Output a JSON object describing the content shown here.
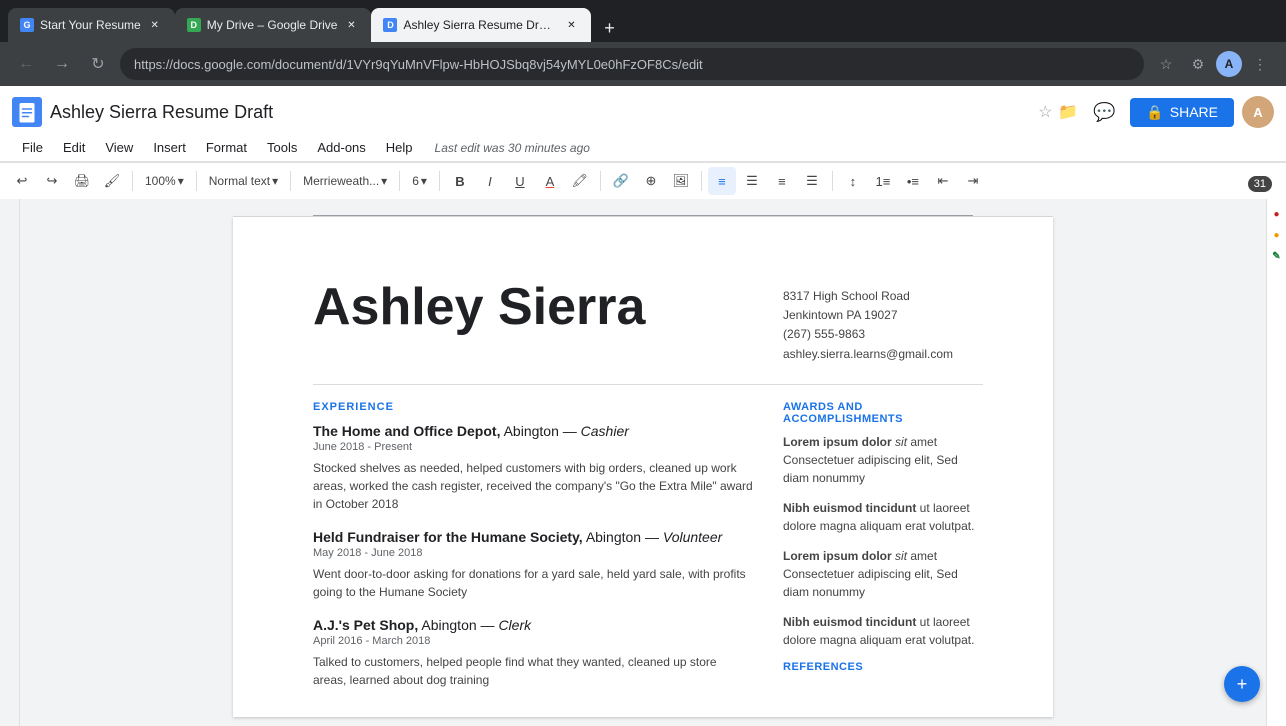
{
  "browser": {
    "tabs": [
      {
        "id": "tab1",
        "favicon_color": "#4285f4",
        "favicon_letter": "G",
        "title": "Start Your Resume",
        "active": false
      },
      {
        "id": "tab2",
        "favicon_color": "#34a853",
        "favicon_letter": "D",
        "title": "My Drive – Google Drive",
        "active": false
      },
      {
        "id": "tab3",
        "favicon_color": "#4285f4",
        "favicon_letter": "D",
        "title": "Ashley Sierra Resume Draft –",
        "active": true
      }
    ],
    "url": "https://docs.google.com/document/d/1VYr9qYuMnVFlpw-HbHOJSbq8vj54yMYL0e0hFzOF8Cs/edit"
  },
  "docs": {
    "title": "Ashley Sierra Resume Draft",
    "last_edit": "Last edit was 30 minutes ago",
    "menu": [
      "File",
      "Edit",
      "View",
      "Insert",
      "Format",
      "Tools",
      "Add-ons",
      "Help"
    ],
    "toolbar": {
      "zoom": "100%",
      "style": "Normal text",
      "font": "Merrieweath...",
      "font_size": "6"
    },
    "share_label": "SHARE"
  },
  "resume": {
    "name": "Ashley Sierra",
    "contact": {
      "address": "8317 High School Road",
      "city_state_zip": "Jenkintown PA 19027",
      "phone": "(267) 555-9863",
      "email": "ashley.sierra.learns@gmail.com"
    },
    "sections": {
      "experience": {
        "heading": "EXPERIENCE",
        "jobs": [
          {
            "title_bold": "The Home and Office Depot,",
            "title_regular": " Abington — ",
            "title_italic": "Cashier",
            "date": "June 2018 - Present",
            "description": "Stocked shelves as needed, helped customers with big orders, cleaned up work areas, worked the cash register, received the company's \"Go the Extra Mile\" award in October 2018"
          },
          {
            "title_bold": "Held Fundraiser for the Humane Society,",
            "title_regular": " Abington — ",
            "title_italic": "Volunteer",
            "date": "May 2018 - June 2018",
            "description": "Went door-to-door asking for donations for a yard sale, held yard sale, with profits going to the Humane Society"
          },
          {
            "title_bold": "A.J.'s Pet Shop,",
            "title_regular": " Abington — ",
            "title_italic": "Clerk",
            "date": "April 2016 - March 2018",
            "description": "Talked to customers, helped people find what they wanted, cleaned up store areas, learned about dog training"
          }
        ]
      },
      "awards": {
        "heading": "AWARDS AND ACCOMPLISHMENTS",
        "entries": [
          {
            "text_bold": "Lorem ipsum dolor",
            "text_italic": " sit",
            "text_regular": " amet Consectetuer adipiscing elit, Sed diam nonummy"
          },
          {
            "text_bold": "Nibh euismod tincidunt",
            "text_regular": " ut laoreet dolore magna aliquam erat volutpat."
          },
          {
            "text_bold": "Lorem ipsum dolor",
            "text_italic": " sit",
            "text_regular": " amet Consectetuer adipiscing elit, Sed diam nonummy"
          },
          {
            "text_bold": "Nibh euismod tincidunt",
            "text_regular": " ut laoreet dolore magna aliquam erat volutpat."
          }
        ]
      },
      "references": {
        "heading": "REFERENCES"
      }
    }
  },
  "page_number": "31",
  "side_icons": [
    "🔴",
    "🟡",
    "🟢"
  ]
}
